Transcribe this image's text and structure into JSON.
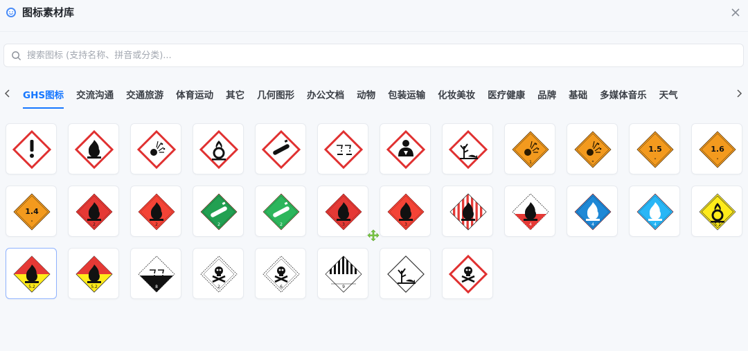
{
  "header": {
    "title": "图标素材库",
    "logo_icon": "smile-icon",
    "close_icon": "close-icon"
  },
  "search": {
    "placeholder": "搜索图标 (支持名称、拼音或分类)...",
    "value": ""
  },
  "tabs": [
    {
      "label": "GHS图标",
      "active": true
    },
    {
      "label": "交流沟通"
    },
    {
      "label": "交通旅游"
    },
    {
      "label": "体育运动"
    },
    {
      "label": "其它"
    },
    {
      "label": "几何图形"
    },
    {
      "label": "办公文档"
    },
    {
      "label": "动物"
    },
    {
      "label": "包装运输"
    },
    {
      "label": "化妆美妆"
    },
    {
      "label": "医疗健康"
    },
    {
      "label": "品牌"
    },
    {
      "label": "基础"
    },
    {
      "label": "多媒体音乐"
    },
    {
      "label": "天气"
    }
  ],
  "icons": [
    {
      "name": "exclamation-mark-icon",
      "kind": "ghs",
      "sym": "exclaim"
    },
    {
      "name": "flame-icon",
      "kind": "ghs",
      "sym": "flame"
    },
    {
      "name": "exploding-bomb-icon",
      "kind": "ghs",
      "sym": "bomb"
    },
    {
      "name": "flame-over-circle-icon",
      "kind": "ghs",
      "sym": "oxid"
    },
    {
      "name": "gas-cylinder-icon",
      "kind": "ghs",
      "sym": "gas"
    },
    {
      "name": "corrosion-icon",
      "kind": "ghs",
      "sym": "corr"
    },
    {
      "name": "health-hazard-icon",
      "kind": "ghs",
      "sym": "health"
    },
    {
      "name": "environment-icon",
      "kind": "ghs",
      "sym": "env"
    },
    {
      "name": "explosive-1-icon",
      "kind": "orange",
      "sym": "bomb",
      "label": "1"
    },
    {
      "name": "explosive-bomb-icon",
      "kind": "orange",
      "sym": "bomb",
      "label": "*"
    },
    {
      "name": "explosive-1-5-icon",
      "kind": "orange",
      "sym": "num",
      "num": "1.5"
    },
    {
      "name": "explosive-1-6-icon",
      "kind": "orange",
      "sym": "num",
      "num": "1.6"
    },
    {
      "name": "explosive-1-4-icon",
      "kind": "orange",
      "sym": "num",
      "num": "1.4"
    },
    {
      "name": "flammable-gas-dark-icon",
      "kind": "red",
      "sym": "flame",
      "label": "2",
      "color": "#e53935"
    },
    {
      "name": "flammable-gas-icon",
      "kind": "red",
      "sym": "flame",
      "label": "2",
      "color": "#f44336"
    },
    {
      "name": "non-flammable-gas-dark-icon",
      "kind": "green",
      "sym": "gas",
      "label": "2",
      "color": "#22a052"
    },
    {
      "name": "non-flammable-gas-icon",
      "kind": "green",
      "sym": "gas",
      "label": "2",
      "color": "#2db65c"
    },
    {
      "name": "flammable-liquid-dark-icon",
      "kind": "red",
      "sym": "flame",
      "label": "3",
      "color": "#e53935"
    },
    {
      "name": "flammable-liquid-icon",
      "kind": "red",
      "sym": "flame",
      "label": "3",
      "color": "#f44336"
    },
    {
      "name": "flammable-solid-icon",
      "kind": "stripes",
      "sym": "flame",
      "label": ""
    },
    {
      "name": "spontaneous-combustion-icon",
      "kind": "halfred",
      "sym": "flame",
      "label": "4"
    },
    {
      "name": "dangerous-when-wet-dark-icon",
      "kind": "blue",
      "sym": "flame",
      "label": "4",
      "color": "#1e88d6"
    },
    {
      "name": "dangerous-when-wet-icon",
      "kind": "blue",
      "sym": "flame",
      "label": "4",
      "color": "#29b6f6"
    },
    {
      "name": "oxidizer-icon",
      "kind": "yellow",
      "sym": "oxid",
      "label": "5.1"
    },
    {
      "name": "organic-peroxide-icon",
      "kind": "redyellow",
      "sym": "flame",
      "label": "5.2",
      "selected": true
    },
    {
      "name": "organic-peroxide-alt-icon",
      "kind": "redyellow",
      "sym": "flame",
      "label": "5.2"
    },
    {
      "name": "corrosive-8-icon",
      "kind": "halfblack",
      "sym": "corr",
      "label": "8"
    },
    {
      "name": "toxic-gas-icon",
      "kind": "white",
      "sym": "skull",
      "label": "2"
    },
    {
      "name": "toxic-6-icon",
      "kind": "white",
      "sym": "skull",
      "label": "6"
    },
    {
      "name": "misc-9-icon",
      "kind": "misc",
      "sym": "none",
      "label": "9"
    },
    {
      "name": "environment-hazard-icon",
      "kind": "whiteplain",
      "sym": "env"
    },
    {
      "name": "skull-crossbones-icon",
      "kind": "ghs",
      "sym": "skull"
    }
  ],
  "cursor_icon": "move-cursor-icon"
}
